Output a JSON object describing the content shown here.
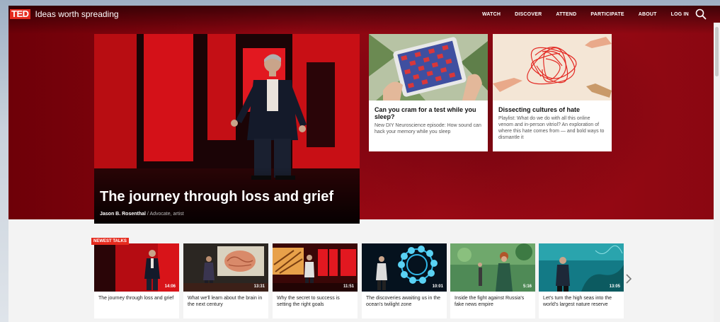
{
  "nav": {
    "logo": "TED",
    "tagline": "Ideas worth spreading",
    "links": [
      "WATCH",
      "DISCOVER",
      "ATTEND",
      "PARTICIPATE",
      "ABOUT",
      "LOG IN"
    ]
  },
  "hero": {
    "title": "The journey through loss and grief",
    "speaker": "Jason B. Rosenthal",
    "separator": "/",
    "speaker_role": "Advocate, artist"
  },
  "cards": [
    {
      "title": "Can you cram for a test while you sleep?",
      "description": "New DIY Neuroscience episode: How sound can hack your memory while you sleep"
    },
    {
      "title": "Dissecting cultures of hate",
      "description": "Playlist: What do we do with all this online venom and in-person vitriol? An exploration of where this hate comes from — and bold ways to dismantle it"
    }
  ],
  "newest_talks": {
    "label": "NEWEST TALKS",
    "items": [
      {
        "title": "The journey through loss and grief",
        "duration": "14:06"
      },
      {
        "title": "What we'll learn about the brain in the next century",
        "duration": "13:31"
      },
      {
        "title": "Why the secret to success is setting the right goals",
        "duration": "11:51"
      },
      {
        "title": "The discoveries awaiting us in the ocean's twilight zone",
        "duration": "10:01"
      },
      {
        "title": "Inside the fight against Russia's fake news empire",
        "duration": "5:16"
      },
      {
        "title": "Let's turn the high seas into the world's largest nature reserve",
        "duration": "13:05"
      }
    ]
  },
  "colors": {
    "brand_red": "#e62b1e",
    "hero_dark": "#6e0008"
  }
}
